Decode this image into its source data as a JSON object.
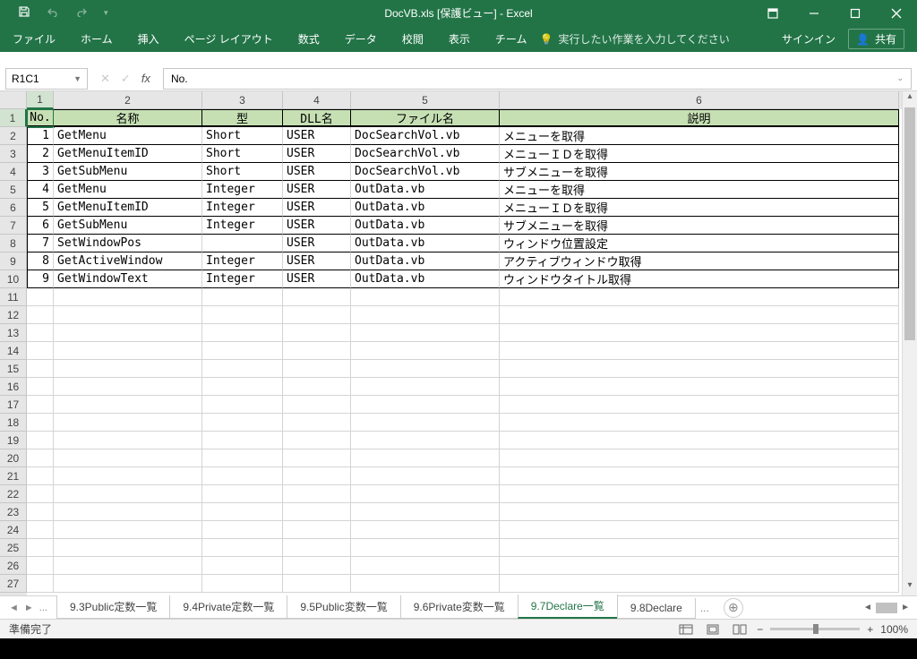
{
  "title": "DocVB.xls  [保護ビュー] - Excel",
  "qat": {
    "save": "save",
    "undo": "undo",
    "redo": "redo"
  },
  "window_controls": {
    "ribbon_display": "⬚",
    "minimize": "—",
    "maximize": "□",
    "close": "✕"
  },
  "ribbon": {
    "tabs": [
      "ファイル",
      "ホーム",
      "挿入",
      "ページ レイアウト",
      "数式",
      "データ",
      "校閲",
      "表示",
      "チーム"
    ],
    "tell_me": "実行したい作業を入力してください",
    "sign_in": "サインイン",
    "share": "共有"
  },
  "name_box": "R1C1",
  "formula": "No.",
  "columns": [
    {
      "n": "1",
      "w": "c1"
    },
    {
      "n": "2",
      "w": "c2"
    },
    {
      "n": "3",
      "w": "c3"
    },
    {
      "n": "4",
      "w": "c4"
    },
    {
      "n": "5",
      "w": "c5"
    },
    {
      "n": "6",
      "w": "c6"
    }
  ],
  "headers": [
    "No.",
    "名称",
    "型",
    "DLL名",
    "ファイル名",
    "説明"
  ],
  "rows": [
    {
      "no": "1",
      "name": "GetMenu",
      "type": "Short",
      "dll": "USER",
      "file": "DocSearchVol.vb",
      "desc": "メニューを取得"
    },
    {
      "no": "2",
      "name": "GetMenuItemID",
      "type": "Short",
      "dll": "USER",
      "file": "DocSearchVol.vb",
      "desc": "メニューＩＤを取得"
    },
    {
      "no": "3",
      "name": "GetSubMenu",
      "type": "Short",
      "dll": "USER",
      "file": "DocSearchVol.vb",
      "desc": "サブメニューを取得"
    },
    {
      "no": "4",
      "name": "GetMenu",
      "type": "Integer",
      "dll": "USER",
      "file": "OutData.vb",
      "desc": "メニューを取得"
    },
    {
      "no": "5",
      "name": "GetMenuItemID",
      "type": "Integer",
      "dll": "USER",
      "file": "OutData.vb",
      "desc": "メニューＩＤを取得"
    },
    {
      "no": "6",
      "name": "GetSubMenu",
      "type": "Integer",
      "dll": "USER",
      "file": "OutData.vb",
      "desc": "サブメニューを取得"
    },
    {
      "no": "7",
      "name": "SetWindowPos",
      "type": "",
      "dll": "USER",
      "file": "OutData.vb",
      "desc": "ウィンドウ位置設定"
    },
    {
      "no": "8",
      "name": "GetActiveWindow",
      "type": "Integer",
      "dll": "USER",
      "file": "OutData.vb",
      "desc": "アクティブウィンドウ取得"
    },
    {
      "no": "9",
      "name": "GetWindowText",
      "type": "Integer",
      "dll": "USER",
      "file": "OutData.vb",
      "desc": "ウィンドウタイトル取得"
    }
  ],
  "empty_rows_start": 11,
  "empty_rows_end": 27,
  "sheets": {
    "ellipsis": "...",
    "tabs": [
      {
        "label": "9.3Public定数一覧",
        "active": false
      },
      {
        "label": "9.4Private定数一覧",
        "active": false
      },
      {
        "label": "9.5Public変数一覧",
        "active": false
      },
      {
        "label": "9.6Private変数一覧",
        "active": false
      },
      {
        "label": "9.7Declare一覧",
        "active": true
      },
      {
        "label": "9.8Declare",
        "active": false
      }
    ],
    "more": "..."
  },
  "status": {
    "ready": "準備完了",
    "zoom": "100%"
  }
}
